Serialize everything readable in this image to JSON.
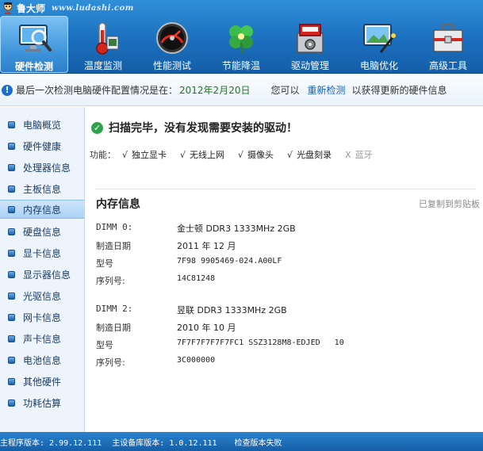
{
  "brand": {
    "name": "鲁大师",
    "url": "www.ludashi.com"
  },
  "nav": [
    {
      "label": "硬件检测",
      "icon": "monitor-magnifier-icon",
      "active": true
    },
    {
      "label": "温度监测",
      "icon": "thermometer-icon",
      "active": false
    },
    {
      "label": "性能测试",
      "icon": "speedometer-icon",
      "active": false
    },
    {
      "label": "节能降温",
      "icon": "clover-leaf-icon",
      "active": false
    },
    {
      "label": "驱动管理",
      "icon": "driver-chip-box-icon",
      "active": false
    },
    {
      "label": "电脑优化",
      "icon": "screen-wand-icon",
      "active": false
    },
    {
      "label": "高级工具",
      "icon": "toolbox-icon",
      "active": false
    }
  ],
  "infobar": {
    "text": "最后一次检测电脑硬件配置情况是在：",
    "date": "2012年2月20日",
    "can": "您可以",
    "link": "重新检测",
    "tail": "以获得更新的硬件信息"
  },
  "sidebar": {
    "items": [
      {
        "label": "电脑概览"
      },
      {
        "label": "硬件健康"
      },
      {
        "label": "处理器信息"
      },
      {
        "label": "主板信息"
      },
      {
        "label": "内存信息"
      },
      {
        "label": "硬盘信息"
      },
      {
        "label": "显卡信息"
      },
      {
        "label": "显示器信息"
      },
      {
        "label": "光驱信息"
      },
      {
        "label": "网卡信息"
      },
      {
        "label": "声卡信息"
      },
      {
        "label": "电池信息"
      },
      {
        "label": "其他硬件"
      },
      {
        "label": "功耗估算"
      }
    ],
    "active_index": 4
  },
  "main": {
    "scan_message": "扫描完毕，没有发现需要安装的驱动！",
    "features_title": "功能：",
    "features": [
      {
        "mark": "√",
        "label": "独立显卡",
        "enabled": true
      },
      {
        "mark": "√",
        "label": "无线上网",
        "enabled": true
      },
      {
        "mark": "√",
        "label": "摄像头",
        "enabled": true
      },
      {
        "mark": "√",
        "label": "光盘刻录",
        "enabled": true
      },
      {
        "mark": "X",
        "label": "蓝牙",
        "enabled": false
      }
    ],
    "section_title": "内存信息",
    "copy_label": "已复制到剪贴板",
    "dimm0": {
      "slot_key": "DIMM 0:",
      "slot_value": "金士顿 DDR3 1333MHz 2GB",
      "date_key": "制造日期",
      "date_value": "2011 年 12 月",
      "model_key": "型号",
      "model_value": "7F98 9905469-024.A00LF",
      "serial_key": "序列号:",
      "serial_value": "14C81248"
    },
    "dimm2": {
      "slot_key": "DIMM 2:",
      "slot_value": "昱联 DDR3 1333MHz 2GB",
      "date_key": "制造日期",
      "date_value": "2010 年 10 月",
      "model_key": "型号",
      "model_value": "7F7F7F7F7F7FC1 SSZ3128M8-EDJED   10",
      "serial_key": "序列号:",
      "serial_value": "3C000000"
    }
  },
  "statusbar": {
    "program_version": "主程序版本: 2.99.12.111",
    "db_version": "主设备库版本: 1.0.12.111",
    "check_status": "检查版本失败"
  },
  "colors": {
    "toolbar": "#1b6fbe",
    "accent_link": "#1a5fb4",
    "date_green": "#1a7a1a",
    "check_green": "#2ea44a"
  }
}
